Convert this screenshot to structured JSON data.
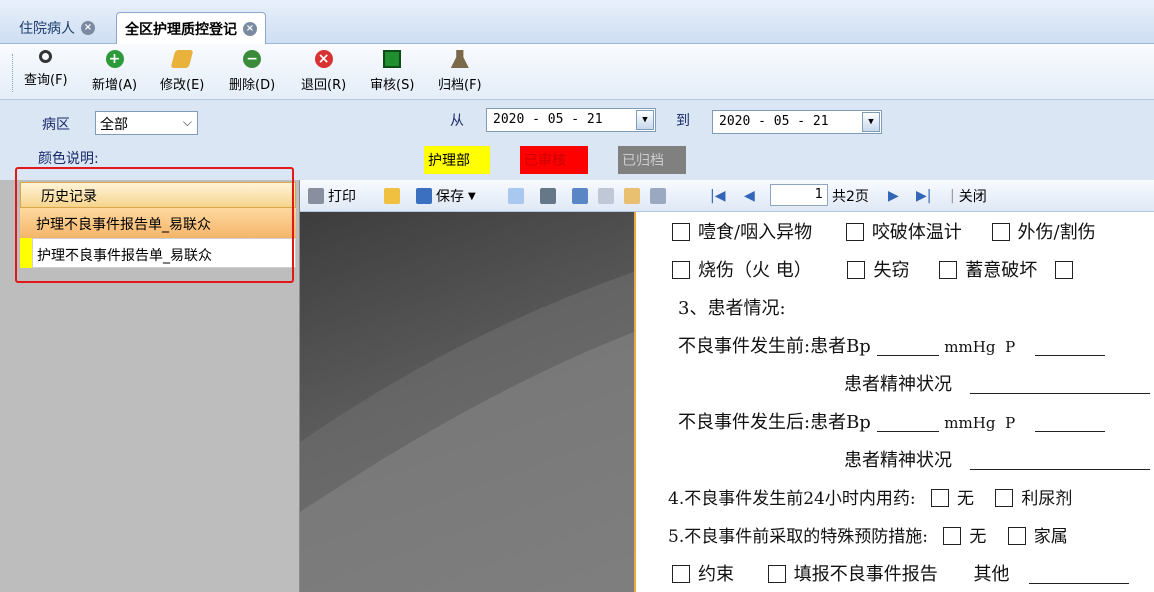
{
  "tabs": [
    {
      "label": "住院病人"
    },
    {
      "label": "全区护理质控登记"
    }
  ],
  "toolbar": {
    "query": "查询(F)",
    "add": "新增(A)",
    "edit": "修改(E)",
    "delete": "删除(D)",
    "back": "退回(R)",
    "audit": "审核(S)",
    "archive": "归档(F)"
  },
  "filter": {
    "ward_label": "病区",
    "ward_value": "全部",
    "from_label": "从",
    "from_date": "2020 - 05 - 21",
    "to_label": "到",
    "to_date": "2020 - 05 - 21",
    "color_label": "颜色说明:",
    "legend": [
      {
        "label": "护理部",
        "color": "#ffff00"
      },
      {
        "label": "已审核",
        "color": "#ff0000"
      },
      {
        "label": "已归档",
        "color": "#808080"
      }
    ]
  },
  "history": {
    "header": "历史记录",
    "items": [
      "护理不良事件报告单_易联众",
      "护理不良事件报告单_易联众"
    ]
  },
  "viewer": {
    "print": "打印",
    "save": "保存",
    "page": "1",
    "total": "共2页",
    "close": "关闭"
  },
  "document": {
    "row1": [
      "噎食/咽入异物",
      "咬破体温计",
      "外伤/割伤"
    ],
    "row2": [
      "烧伤（火 电）",
      "失窃",
      "蓄意破坏"
    ],
    "section3": "3、患者情况:",
    "before_label": "不良事件发生前:患者Bp",
    "unit_mmhg": "mmHg",
    "unit_p": "P",
    "mental": "患者精神状况",
    "after_label": "不良事件发生后:患者Bp",
    "q4": "4.不良事件发生前24小时内用药:",
    "q4_opts": [
      "无",
      "利尿剂"
    ],
    "q5": "5.不良事件前采取的特殊预防措施:",
    "q5_opts": [
      "无",
      "家属"
    ],
    "last_row": [
      "约束",
      "填报不良事件报告"
    ],
    "other": "其他"
  }
}
